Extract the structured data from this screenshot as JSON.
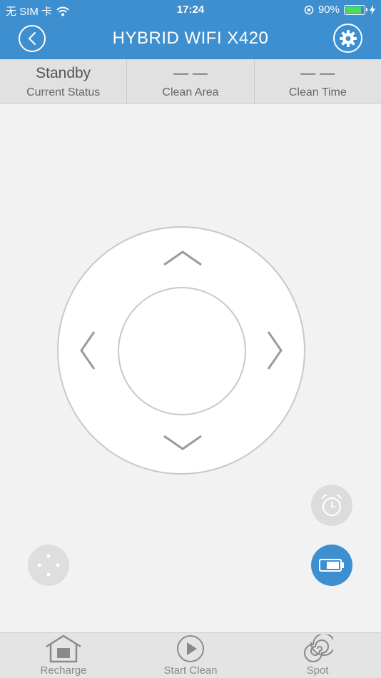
{
  "status_bar": {
    "carrier": "无 SIM 卡",
    "time": "17:24",
    "battery_percent": "90%",
    "battery_level": 0.9,
    "battery_color": "#4cd964"
  },
  "header": {
    "title": "HYBRID WIFI X420",
    "back_icon": "chevron-left-icon",
    "settings_icon": "gear-icon",
    "color": "#3d8fcf"
  },
  "stats": [
    {
      "value": "Standby",
      "label": "Current Status"
    },
    {
      "value": "— —",
      "label": "Clean Area"
    },
    {
      "value": "— —",
      "label": "Clean Time"
    }
  ],
  "controls": {
    "dpad_icons": [
      "arrow-up-icon",
      "arrow-down-icon",
      "arrow-left-icon",
      "arrow-right-icon"
    ],
    "alarm_icon": "alarm-clock-icon",
    "battery_icon": "battery-icon",
    "mode_icon": "four-dots-icon"
  },
  "tabs": [
    {
      "label": "Recharge",
      "icon": "home-dock-icon"
    },
    {
      "label": "Start Clean",
      "icon": "play-icon"
    },
    {
      "label": "Spot",
      "icon": "spiral-icon"
    }
  ]
}
